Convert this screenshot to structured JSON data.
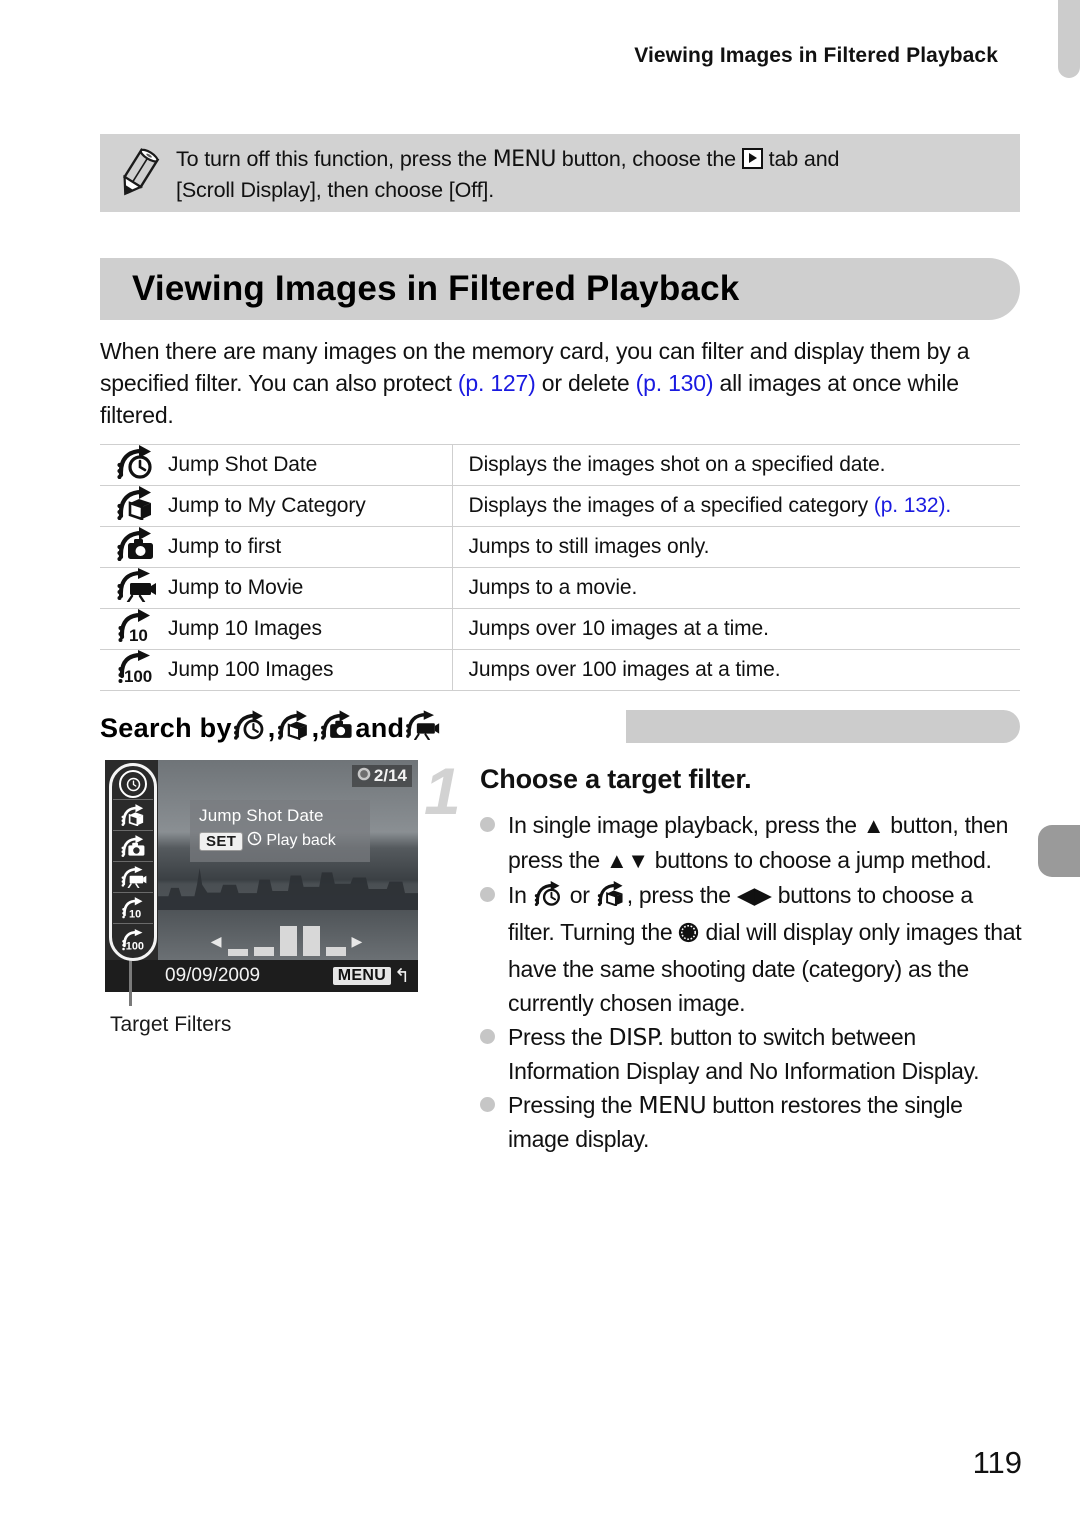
{
  "running_head": "Viewing Images in Filtered Playback",
  "note": {
    "icon": "pencil-icon",
    "line1_a": "To turn off this function, press the ",
    "line1_menu": "MENU",
    "line1_b": " button, choose the ",
    "line1_tab": "playback-tab-icon",
    "line1_c": " tab and",
    "line2": "[Scroll Display], then choose [Off]."
  },
  "section": {
    "title": "Viewing Images in Filtered Playback",
    "intro_a": "When there are many images on the memory card, you can filter and display them by a specified filter. You can also protect ",
    "intro_ref1": "(p. 127)",
    "intro_b": " or delete ",
    "intro_ref2": "(p. 130)",
    "intro_c": " all images at once while filtered."
  },
  "filter_table": {
    "rows": [
      {
        "icon": "jump-shot-date-icon",
        "name": "Jump Shot Date",
        "desc": "Displays the images shot on a specified date.",
        "ref": ""
      },
      {
        "icon": "jump-my-category-icon",
        "name": "Jump to My Category",
        "desc": "Displays the images of a specified category ",
        "ref": "(p. 132)."
      },
      {
        "icon": "jump-to-first-icon",
        "name": "Jump to first",
        "desc": "Jumps to still images only.",
        "ref": ""
      },
      {
        "icon": "jump-to-movie-icon",
        "name": "Jump to Movie",
        "desc": "Jumps to a movie.",
        "ref": ""
      },
      {
        "icon": "jump-10-images-icon",
        "name": "Jump 10 Images",
        "desc": "Jumps over 10 images at a time.",
        "ref": ""
      },
      {
        "icon": "jump-100-images-icon",
        "name": "Jump 100 Images",
        "desc": "Jumps over 100 images at a time.",
        "ref": ""
      }
    ]
  },
  "subhead": {
    "lead": "Search by ",
    "sep1": ", ",
    "sep2": ", ",
    "and": " and "
  },
  "lcd": {
    "counter": "2/14",
    "toast_title": "Jump Shot Date",
    "set_badge": "SET",
    "playback_label": "Play back",
    "date": "09/09/2009",
    "menu_badge": "MENU",
    "return_arrow": "↰"
  },
  "caption": "Target Filters",
  "step": {
    "number": "1",
    "title": "Choose a target filter.",
    "bullets": [
      {
        "id": "bullet-press-up",
        "parts": [
          {
            "t": "text",
            "v": "In single image playback, press the "
          },
          {
            "t": "glyph",
            "v": "▲"
          },
          {
            "t": "text",
            "v": " button, then press the "
          },
          {
            "t": "glyph",
            "v": "▲▼"
          },
          {
            "t": "text",
            "v": " buttons to choose a jump method."
          }
        ]
      },
      {
        "id": "bullet-choose-filter",
        "parts": [
          {
            "t": "text",
            "v": "In "
          },
          {
            "t": "icon",
            "v": "jump-shot-date-icon"
          },
          {
            "t": "text",
            "v": " or "
          },
          {
            "t": "icon",
            "v": "jump-my-category-icon"
          },
          {
            "t": "text",
            "v": ", press the "
          },
          {
            "t": "glyph",
            "v": "◀▶"
          },
          {
            "t": "text",
            "v": " buttons to choose a filter. Turning the "
          },
          {
            "t": "icon",
            "v": "control-dial-icon"
          },
          {
            "t": "text",
            "v": " dial will display only images that have the same shooting date (category) as the currently chosen image."
          }
        ]
      },
      {
        "id": "bullet-disp",
        "parts": [
          {
            "t": "text",
            "v": "Press the "
          },
          {
            "t": "word",
            "v": "DISP."
          },
          {
            "t": "text",
            "v": " button to switch between Information Display and No Information Display."
          }
        ]
      },
      {
        "id": "bullet-menu",
        "parts": [
          {
            "t": "text",
            "v": "Pressing the "
          },
          {
            "t": "word",
            "v": "MENU"
          },
          {
            "t": "text",
            "v": " button restores the single image display."
          }
        ]
      }
    ]
  },
  "folio": "119",
  "colors": {
    "reference_link": "#1a1ae0",
    "band_gray": "#cfcfcf",
    "note_gray": "#d2d2d2",
    "tab_gray": "#9a9a9a",
    "bullet_dot": "#c6c6c6"
  }
}
